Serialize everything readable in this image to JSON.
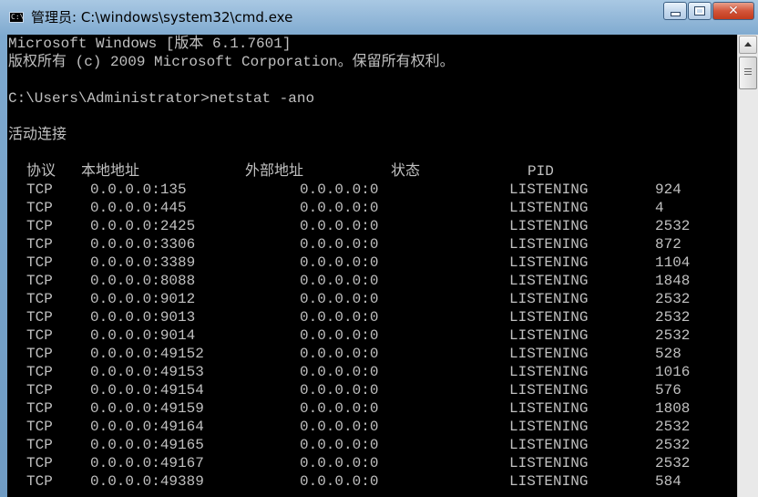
{
  "window": {
    "title": "管理员: C:\\windows\\system32\\cmd.exe",
    "icon_text": "C:\\",
    "controls": {
      "minimize": "minimize-icon",
      "maximize": "maximize-icon",
      "close": "✕"
    }
  },
  "console": {
    "header_lines": [
      "Microsoft Windows [版本 6.1.7601]",
      "版权所有 (c) 2009 Microsoft Corporation。保留所有权利。",
      "",
      "C:\\Users\\Administrator>netstat -ano",
      "",
      "活动连接"
    ],
    "columns": {
      "proto": "协议",
      "local": "本地地址",
      "foreign": "外部地址",
      "state": "状态",
      "pid": "PID"
    },
    "rows": [
      {
        "proto": "TCP",
        "local": "0.0.0.0:135",
        "foreign": "0.0.0.0:0",
        "state": "LISTENING",
        "pid": "924"
      },
      {
        "proto": "TCP",
        "local": "0.0.0.0:445",
        "foreign": "0.0.0.0:0",
        "state": "LISTENING",
        "pid": "4"
      },
      {
        "proto": "TCP",
        "local": "0.0.0.0:2425",
        "foreign": "0.0.0.0:0",
        "state": "LISTENING",
        "pid": "2532"
      },
      {
        "proto": "TCP",
        "local": "0.0.0.0:3306",
        "foreign": "0.0.0.0:0",
        "state": "LISTENING",
        "pid": "872"
      },
      {
        "proto": "TCP",
        "local": "0.0.0.0:3389",
        "foreign": "0.0.0.0:0",
        "state": "LISTENING",
        "pid": "1104"
      },
      {
        "proto": "TCP",
        "local": "0.0.0.0:8088",
        "foreign": "0.0.0.0:0",
        "state": "LISTENING",
        "pid": "1848"
      },
      {
        "proto": "TCP",
        "local": "0.0.0.0:9012",
        "foreign": "0.0.0.0:0",
        "state": "LISTENING",
        "pid": "2532"
      },
      {
        "proto": "TCP",
        "local": "0.0.0.0:9013",
        "foreign": "0.0.0.0:0",
        "state": "LISTENING",
        "pid": "2532"
      },
      {
        "proto": "TCP",
        "local": "0.0.0.0:9014",
        "foreign": "0.0.0.0:0",
        "state": "LISTENING",
        "pid": "2532"
      },
      {
        "proto": "TCP",
        "local": "0.0.0.0:49152",
        "foreign": "0.0.0.0:0",
        "state": "LISTENING",
        "pid": "528"
      },
      {
        "proto": "TCP",
        "local": "0.0.0.0:49153",
        "foreign": "0.0.0.0:0",
        "state": "LISTENING",
        "pid": "1016"
      },
      {
        "proto": "TCP",
        "local": "0.0.0.0:49154",
        "foreign": "0.0.0.0:0",
        "state": "LISTENING",
        "pid": "576"
      },
      {
        "proto": "TCP",
        "local": "0.0.0.0:49159",
        "foreign": "0.0.0.0:0",
        "state": "LISTENING",
        "pid": "1808"
      },
      {
        "proto": "TCP",
        "local": "0.0.0.0:49164",
        "foreign": "0.0.0.0:0",
        "state": "LISTENING",
        "pid": "2532"
      },
      {
        "proto": "TCP",
        "local": "0.0.0.0:49165",
        "foreign": "0.0.0.0:0",
        "state": "LISTENING",
        "pid": "2532"
      },
      {
        "proto": "TCP",
        "local": "0.0.0.0:49167",
        "foreign": "0.0.0.0:0",
        "state": "LISTENING",
        "pid": "2532"
      },
      {
        "proto": "TCP",
        "local": "0.0.0.0:49389",
        "foreign": "0.0.0.0:0",
        "state": "LISTENING",
        "pid": "584"
      }
    ]
  },
  "colors": {
    "console_bg": "#000000",
    "console_text": "#c0c0c0",
    "close_button": "#c94a2c"
  }
}
